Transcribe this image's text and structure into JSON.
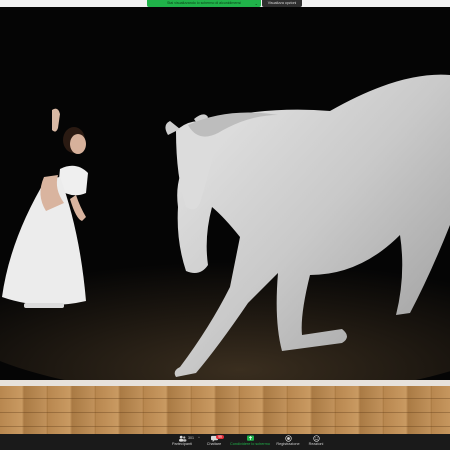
{
  "banner": {
    "share_status": "Stai visualizzando lo schermo di alcunidimensi",
    "view_options": "Visualizza opzioni"
  },
  "toolbar": {
    "participants": {
      "label": "Partecipanti",
      "count": "301"
    },
    "chat": {
      "label": "Chattare",
      "badge": "99"
    },
    "share": {
      "label": "Condividere lo schermo"
    },
    "record": {
      "label": "Registrazione"
    },
    "reactions": {
      "label": "Reazioni"
    }
  },
  "colors": {
    "accent": "#20b34a",
    "alert": "#e0303a",
    "toolbar_bg": "#1a1a1a"
  },
  "icons": {
    "participants": "people-icon",
    "chat": "chat-bubble-icon",
    "share": "screen-share-icon",
    "record": "record-icon",
    "reactions": "smiley-icon"
  }
}
